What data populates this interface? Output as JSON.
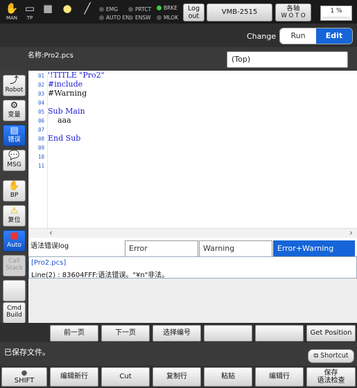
{
  "topbar": {
    "icons": [
      {
        "name": "man-icon",
        "label": "MAN"
      },
      {
        "name": "teach-pendant-icon",
        "label": "TP"
      },
      {
        "name": "stop-square-icon",
        "label": ""
      },
      {
        "name": "lamp-icon",
        "label": ""
      },
      {
        "name": "wrench-icon",
        "label": ""
      }
    ],
    "indicators": {
      "emg": "EMG",
      "auto_en": "AUTO EN",
      "prtct": "PRTCT",
      "ensw": "ENSW",
      "brke": "BRKE",
      "mlok": "MLOK"
    },
    "logout_label_1": "Log",
    "logout_label_2": "out",
    "robot_name": "VMB-2515",
    "axis_label_1": "各轴",
    "axis_label_2": "W O T O",
    "speed": "1 %",
    "brke_on": true
  },
  "mode": {
    "change_label": "Change",
    "run_label": "Run",
    "edit_label": "Edit",
    "selected": "Edit"
  },
  "file": {
    "name_label": "名称:Pro2.pcs",
    "section": "(Top)"
  },
  "sidebar": {
    "robot": "Robot",
    "variable": "变量",
    "error": "错误",
    "msg": "MSG",
    "bp": "BP",
    "reset": "复位",
    "auto": "Auto",
    "callstack_1": "Call",
    "callstack_2": "Stack",
    "blank": "",
    "cmd_1": "Cmd",
    "cmd_2": "Build"
  },
  "editor": {
    "lines": [
      {
        "num": "01",
        "text": "'!TITLE \"Pro2\""
      },
      {
        "num": "02",
        "text": "#include"
      },
      {
        "num": "03",
        "text": "#Warning"
      },
      {
        "num": "04",
        "text": ""
      },
      {
        "num": "05",
        "text": "Sub Main"
      },
      {
        "num": "06",
        "text": "    aaa"
      },
      {
        "num": "07",
        "text": ""
      },
      {
        "num": "08",
        "text": "End Sub"
      },
      {
        "num": "09",
        "text": ""
      },
      {
        "num": "10",
        "text": ""
      },
      {
        "num": "11",
        "text": ""
      }
    ]
  },
  "log": {
    "title": "语法错误log",
    "tabs": [
      "Error",
      "Warning",
      "Error+Warning"
    ],
    "active_tab": "Error+Warning",
    "file": "[Pro2.pcs]",
    "message": "Line(2) : 83604FFF:语法错误。\"¥n\"非法。"
  },
  "function_keys": [
    "前一页",
    "下一页",
    "选择编号",
    "",
    "",
    "Get Position"
  ],
  "status": {
    "text": "已保存文件。",
    "shortcut": "Shortcut"
  },
  "bottom_keys": {
    "shift": "SHIFT",
    "k1": "编辑新行",
    "k2": "Cut",
    "k3": "复制行",
    "k4": "粘贴",
    "k5": "编辑行",
    "k6_1": "保存",
    "k6_2": "语法检查"
  },
  "colors": {
    "accent": "#1565d8",
    "code_blue": "#1b1bd6",
    "line_number": "#2b63c7",
    "brke_led": "#39d23a"
  }
}
